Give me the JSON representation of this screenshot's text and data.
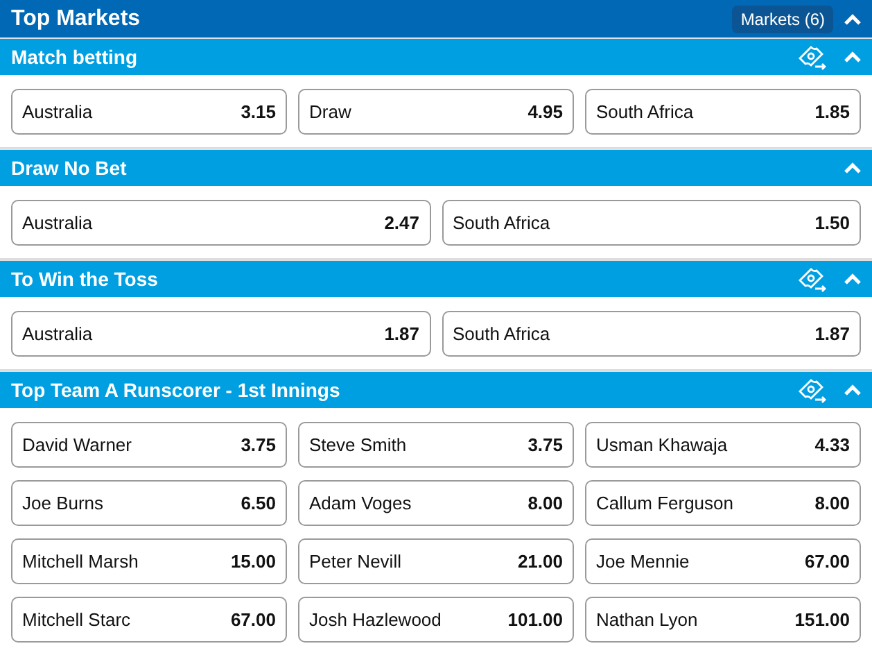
{
  "header": {
    "title": "Top Markets",
    "markets_button": "Markets (6)",
    "expanded": true
  },
  "sections": [
    {
      "title": "Match betting",
      "cash_out": true,
      "expanded": true,
      "rows": [
        [
          {
            "name": "Australia",
            "odds": "3.15"
          },
          {
            "name": "Draw",
            "odds": "4.95"
          },
          {
            "name": "South Africa",
            "odds": "1.85"
          }
        ]
      ]
    },
    {
      "title": "Draw No Bet",
      "cash_out": false,
      "expanded": true,
      "rows": [
        [
          {
            "name": "Australia",
            "odds": "2.47"
          },
          {
            "name": "South Africa",
            "odds": "1.50"
          }
        ]
      ]
    },
    {
      "title": "To Win the Toss",
      "cash_out": true,
      "expanded": true,
      "rows": [
        [
          {
            "name": "Australia",
            "odds": "1.87"
          },
          {
            "name": "South Africa",
            "odds": "1.87"
          }
        ]
      ]
    },
    {
      "title": "Top Team A Runscorer - 1st Innings",
      "cash_out": true,
      "expanded": true,
      "rows": [
        [
          {
            "name": "David Warner",
            "odds": "3.75"
          },
          {
            "name": "Steve Smith",
            "odds": "3.75"
          },
          {
            "name": "Usman Khawaja",
            "odds": "4.33"
          }
        ],
        [
          {
            "name": "Joe Burns",
            "odds": "6.50"
          },
          {
            "name": "Adam Voges",
            "odds": "8.00"
          },
          {
            "name": "Callum Ferguson",
            "odds": "8.00"
          }
        ],
        [
          {
            "name": "Mitchell Marsh",
            "odds": "15.00"
          },
          {
            "name": "Peter Nevill",
            "odds": "21.00"
          },
          {
            "name": "Joe Mennie",
            "odds": "67.00"
          }
        ],
        [
          {
            "name": "Mitchell Starc",
            "odds": "67.00"
          },
          {
            "name": "Josh Hazlewood",
            "odds": "101.00"
          },
          {
            "name": "Nathan Lyon",
            "odds": "151.00"
          }
        ]
      ]
    }
  ]
}
